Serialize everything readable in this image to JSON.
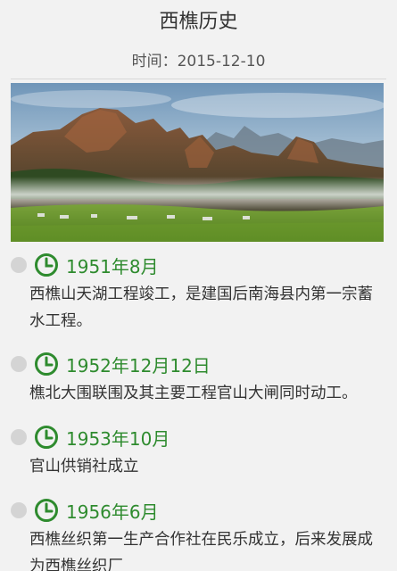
{
  "header": {
    "title": "西樵历史",
    "time_label": "时间：",
    "time_value": "2015-12-10"
  },
  "timeline": {
    "entries": [
      {
        "date": "1951年8月",
        "text": "西樵山天湖工程竣工，是建国后南海县内第一宗蓄水工程。"
      },
      {
        "date": "1952年12月12日",
        "text": "樵北大围联围及其主要工程官山大闸同时动工。"
      },
      {
        "date": "1953年10月",
        "text": "官山供销社成立"
      },
      {
        "date": "1956年6月",
        "text": "西樵丝织第一生产合作社在民乐成立，后来发展成为西樵丝织厂"
      }
    ]
  },
  "colors": {
    "accent": "#2e8b2e",
    "dot": "#d4d4d4",
    "background": "#f2f2f2"
  },
  "icons": {
    "clock": "clock-icon",
    "timeline_dot": "timeline-dot"
  }
}
